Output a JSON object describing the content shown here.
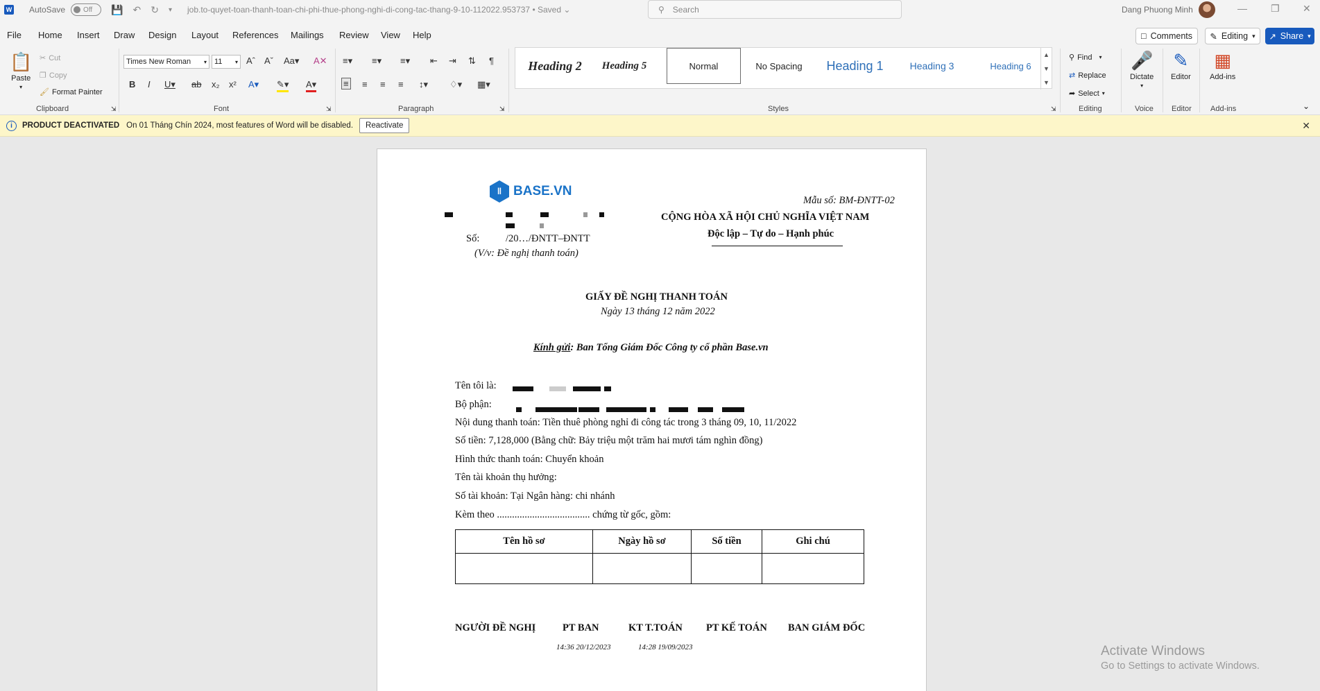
{
  "titlebar": {
    "app_logo": "W",
    "autosave_label": "AutoSave",
    "autosave_state": "Off",
    "document_name": "job.to-quyet-toan-thanh-toan-chi-phi-thue-phong-nghi-di-cong-tac-thang-9-10-112022.953737",
    "save_status": "• Saved",
    "search_placeholder": "Search",
    "user_name": "Dang Phuong Minh"
  },
  "menu": {
    "tabs": [
      "File",
      "Home",
      "Insert",
      "Draw",
      "Design",
      "Layout",
      "References",
      "Mailings",
      "Review",
      "View",
      "Help"
    ],
    "comments_label": "Comments",
    "editing_label": "Editing",
    "share_label": "Share"
  },
  "ribbon": {
    "clipboard": {
      "paste": "Paste",
      "cut": "Cut",
      "copy": "Copy",
      "format_painter": "Format Painter",
      "label": "Clipboard"
    },
    "font": {
      "name": "Times New Roman",
      "size": "11",
      "label": "Font"
    },
    "paragraph": {
      "label": "Paragraph"
    },
    "styles": {
      "items": [
        "Heading 2",
        "Heading 5",
        "Normal",
        "No Spacing",
        "Heading 1",
        "Heading 3",
        "Heading 6"
      ],
      "label": "Styles"
    },
    "editing": {
      "find": "Find",
      "replace": "Replace",
      "select": "Select",
      "label": "Editing"
    },
    "voice": {
      "dictate": "Dictate",
      "label": "Voice"
    },
    "editor": {
      "editor": "Editor",
      "label": "Editor"
    },
    "addins": {
      "addins": "Add-ins",
      "label": "Add-ins"
    }
  },
  "infobar": {
    "title": "PRODUCT DEACTIVATED",
    "message": "On 01 Tháng Chín 2024, most features of Word will be disabled.",
    "button": "Reactivate"
  },
  "document": {
    "logo_text": "BASE.VN",
    "form_number": "Mẫu số: BM-ĐNTT-02",
    "republic": "CỘNG HÒA XÃ HỘI CHỦ NGHĨA VIỆT NAM",
    "motto": "Độc lập – Tự do – Hạnh phúc",
    "so_label": "Số:",
    "so_value": "/20…/ĐNTT–ĐNTT",
    "subject": "(V/v: Đề nghị thanh toán)",
    "title": "GIẤY ĐỀ NGHỊ THANH TOÁN",
    "date": "Ngày 13 tháng 12 năm 2022",
    "recipient_label": "Kính gửi",
    "recipient": ": Ban Tổng Giám Đốc Công ty cổ phần Base.vn",
    "lines": [
      "Tên tôi là:",
      "Bộ phận:",
      "Nội dung thanh toán: Tiền thuê phòng nghỉ đi công tác trong 3 tháng 09, 10, 11/2022",
      "Số tiền: 7,128,000 (Bằng chữ: Bảy triệu một trăm hai mươi tám nghìn đồng)",
      "Hình thức thanh toán: Chuyển khoản",
      "Tên tài khoản thụ hưởng:",
      "Số tài khoản:  Tại Ngân hàng:  chi nhánh",
      "Kèm theo ..................................... chứng từ gốc, gồm:"
    ],
    "table_headers": [
      "Tên hồ sơ",
      "Ngày hồ sơ",
      "Số tiền",
      "Ghi chú"
    ],
    "signatures": [
      "NGƯỜI ĐỀ NGHỊ",
      "PT BAN",
      "KT T.TOÁN",
      "PT KẾ TOÁN",
      "BAN GIÁM ĐỐC"
    ],
    "timestamps": [
      "14:36 20/12/2023",
      "14:28 19/09/2023"
    ]
  },
  "watermark": {
    "line1": "Activate Windows",
    "line2": "Go to Settings to activate Windows."
  },
  "colors": {
    "accent": "#185abd",
    "infobar": "#fdf6c9",
    "logo_blue": "#1a73c8"
  }
}
